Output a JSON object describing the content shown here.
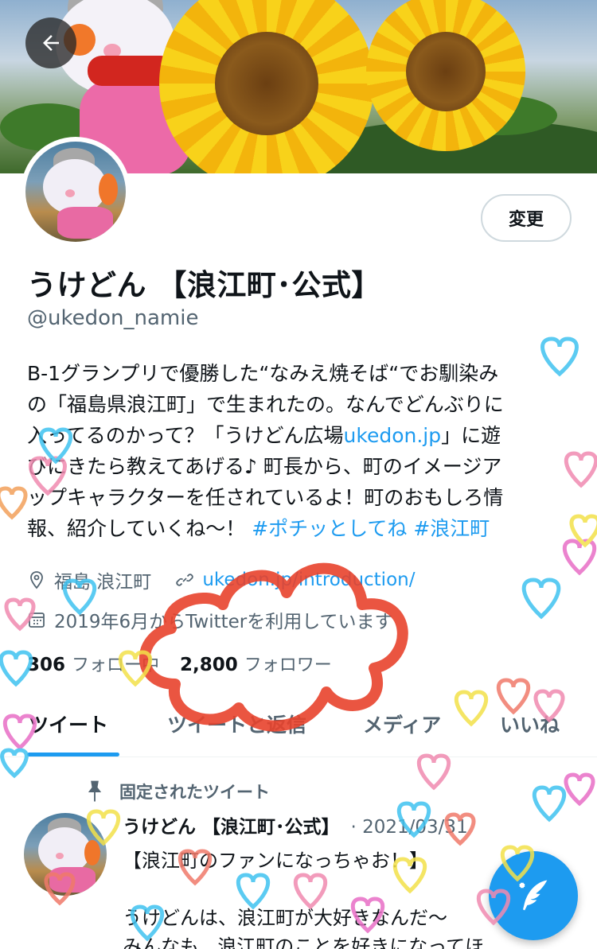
{
  "profile": {
    "display_name": "うけどん 【浪江町･公式】",
    "handle": "@ukedon_namie",
    "edit_label": "変更",
    "bio": {
      "line1": "B-1グランプリで優勝した“なみえ焼そば“でお馴染み",
      "line2": "の「福島県浪江町」で生まれたの。なんでどんぶりに",
      "line3a": "入ってるのかって？「うけどん広場",
      "line3_link": "ukedon.jp",
      "line3b": "」に遊",
      "line4": "びにきたら教えてあげる♪ 町長から、町のイメージア",
      "line5": "ップキャラクターを任されているよ！町のおもしろ情",
      "line6a": "報、紹介していくね〜！ ",
      "hashtag1": "#ポチッとしてね",
      "hashtag2": "#浪江町"
    },
    "location": "福島 浪江町",
    "website": "ukedon.jp/introduction/",
    "joined": "2019年6月からTwitterを利用しています",
    "following_count": "306",
    "following_label": "フォロー中",
    "followers_count": "2,800",
    "followers_label": "フォロワー"
  },
  "tabs": [
    {
      "label": "ツイート"
    },
    {
      "label": "ツイートと返信"
    },
    {
      "label": "メディア"
    },
    {
      "label": "いいね"
    }
  ],
  "pinned_tweet": {
    "pinned_label": "固定されたツイート",
    "author": "うけどん 【浪江町･公式】",
    "date": "· 2021/03/31",
    "text": "【浪江町のファンになっちゃお！】\n\nうけどんは、浪江町が大好きなんだ〜\nみんなも、浪江町のことを好きになってほ"
  },
  "icons": {
    "back": "back-arrow-icon",
    "location": "location-pin-icon",
    "link": "link-icon",
    "calendar": "calendar-icon",
    "pin": "pin-icon",
    "compose": "compose-feather-icon"
  },
  "colors": {
    "accent": "#1d9bf0",
    "text": "#0f1419",
    "muted": "#536471",
    "scribble": "#e8432c"
  }
}
